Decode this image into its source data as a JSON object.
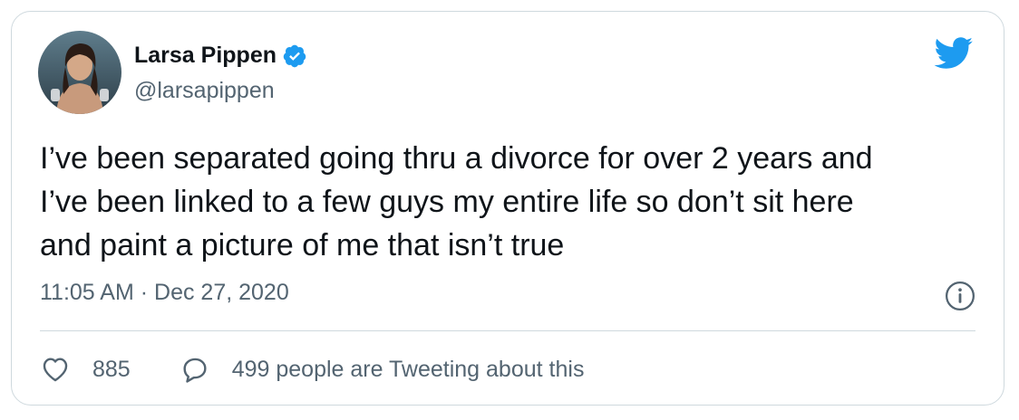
{
  "tweet": {
    "author_name": "Larsa Pippen",
    "author_handle": "@larsapippen",
    "verified_icon": "verified-badge-icon",
    "platform_icon": "twitter-bird-icon",
    "text": "I’ve been separated going thru a divorce for over 2 years and\nI’ve been linked to a few guys my entire life so don’t sit here\nand paint a picture of me that isn’t true",
    "time": "11:05 AM",
    "separator": "·",
    "date": "Dec 27, 2020",
    "info_icon": "info-icon"
  },
  "actions": {
    "likes": "885",
    "replies_label": "499 people are Tweeting about this",
    "like_icon": "heart-icon",
    "reply_icon": "speech-bubble-icon"
  },
  "colors": {
    "brand": "#1d9bf0",
    "text": "#0f1419",
    "secondary": "#536471",
    "border": "#cfd9de"
  }
}
